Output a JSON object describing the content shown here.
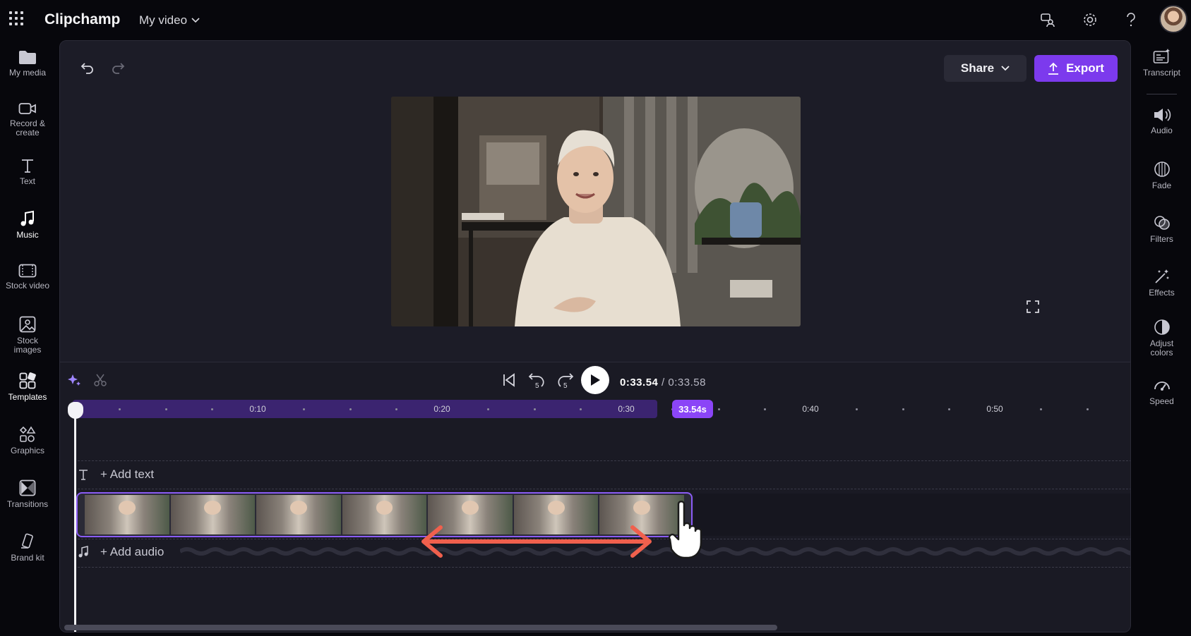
{
  "app": {
    "name": "Clipchamp",
    "project_title": "My video"
  },
  "left_nav": [
    {
      "label": "My media",
      "icon": "folder-icon"
    },
    {
      "label": "Record &\ncreate",
      "icon": "camera-icon"
    },
    {
      "label": "Text",
      "icon": "text-icon"
    },
    {
      "label": "Music",
      "icon": "music-note-icon"
    },
    {
      "label": "Stock video",
      "icon": "film-icon"
    },
    {
      "label": "Stock\nimages",
      "icon": "image-icon"
    },
    {
      "label": "Templates",
      "icon": "templates-icon"
    },
    {
      "label": "Graphics",
      "icon": "shapes-icon"
    },
    {
      "label": "Transitions",
      "icon": "transition-icon"
    },
    {
      "label": "Brand kit",
      "icon": "brand-kit-icon"
    }
  ],
  "right_panel": [
    {
      "label": "Transcript",
      "icon": "transcript-icon"
    },
    {
      "label": "Audio",
      "icon": "speaker-icon"
    },
    {
      "label": "Fade",
      "icon": "fade-icon"
    },
    {
      "label": "Filters",
      "icon": "filters-icon"
    },
    {
      "label": "Effects",
      "icon": "magic-wand-icon"
    },
    {
      "label": "Adjust\ncolors",
      "icon": "contrast-icon"
    },
    {
      "label": "Speed",
      "icon": "speedometer-icon"
    }
  ],
  "toolbar": {
    "share_label": "Share",
    "export_label": "Export"
  },
  "playback": {
    "current_time": "0:33.54",
    "duration": "/ 0:33.58",
    "skip_back_seconds": "5",
    "skip_forward_seconds": "5"
  },
  "ruler": {
    "ticks": [
      "0:10",
      "0:20",
      "0:30",
      "0:40",
      "0:50"
    ],
    "playhead_badge": "33.54s"
  },
  "tracks": {
    "add_text": "+ Add text",
    "add_audio": "+ Add audio"
  },
  "colors": {
    "accent": "#7c3aed",
    "badge": "#8b45f7",
    "arrow": "#f0604d"
  }
}
